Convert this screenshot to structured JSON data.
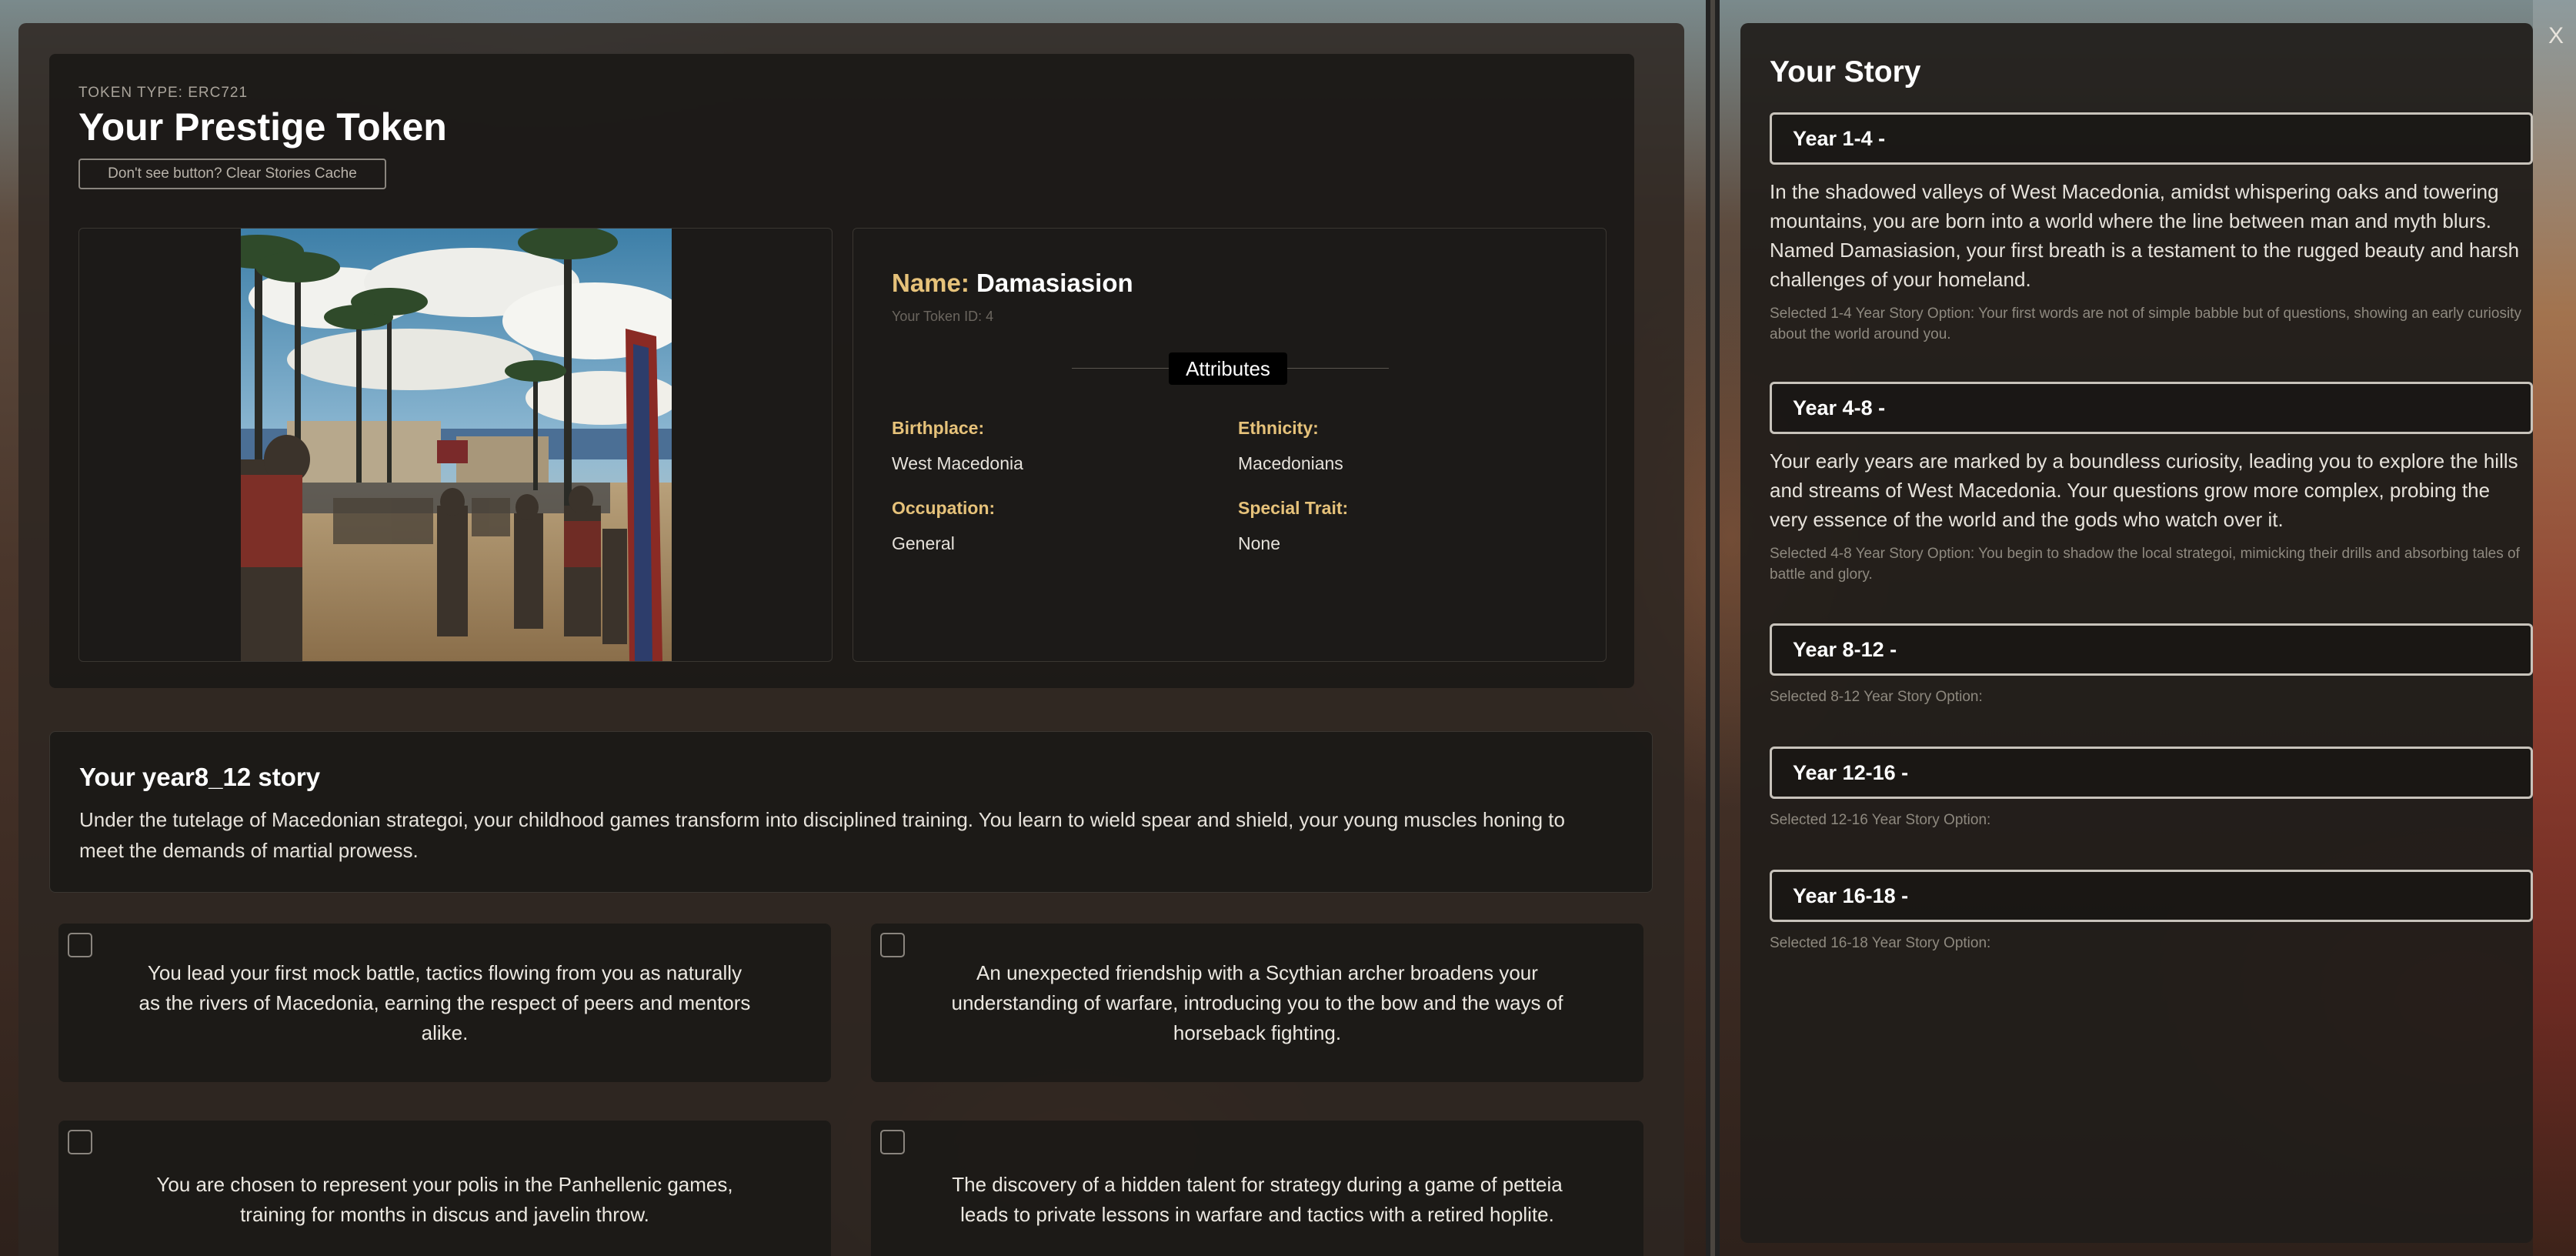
{
  "token": {
    "type_label": "TOKEN TYPE: ERC721",
    "title": "Your Prestige Token",
    "cache_button": "Don't see button? Clear Stories Cache",
    "name_label": "Name:",
    "name": "Damasiasion",
    "token_id": "Your Token ID: 4",
    "attributes_label": "Attributes",
    "attributes": [
      {
        "label": "Birthplace:",
        "value": "West Macedonia"
      },
      {
        "label": "Ethnicity:",
        "value": "Macedonians"
      },
      {
        "label": "Occupation:",
        "value": "General"
      },
      {
        "label": "Special Trait:",
        "value": "None"
      }
    ]
  },
  "current_story": {
    "title": "Your year8_12 story",
    "text": "Under the tutelage of Macedonian strategoi, your childhood games transform into disciplined training. You learn to wield spear and shield, your young muscles honing to meet the demands of martial prowess."
  },
  "options": [
    {
      "text": "You lead your first mock battle, tactics flowing from you as naturally as the rivers of Macedonia, earning the respect of peers and mentors alike.",
      "checked": false
    },
    {
      "text": "An unexpected friendship with a Scythian archer broadens your understanding of warfare, introducing you to the bow and the ways of horseback fighting.",
      "checked": false
    },
    {
      "text": "You are chosen to represent your polis in the Panhellenic games, training for months in discus and javelin throw.",
      "checked": false
    },
    {
      "text": "The discovery of a hidden talent for strategy during a game of petteia leads to private lessons in warfare and tactics with a retired hoplite.",
      "checked": false
    }
  ],
  "your_story": {
    "title": "Your Story",
    "close": "X",
    "years": [
      {
        "label": "Year 1-4 -",
        "story": "In the shadowed valleys of West Macedonia, amidst whispering oaks and towering mountains, you are born into a world where the line between man and myth blurs. Named Damasiasion, your first breath is a testament to the rugged beauty and harsh challenges of your homeland.",
        "selected": "Selected 1-4 Year Story Option: Your first words are not of simple babble but of questions, showing an early curiosity about the world around you."
      },
      {
        "label": "Year 4-8 -",
        "story": "Your early years are marked by a boundless curiosity, leading you to explore the hills and streams of West Macedonia. Your questions grow more complex, probing the very essence of the world and the gods who watch over it.",
        "selected": "Selected 4-8 Year Story Option: You begin to shadow the local strategoi, mimicking their drills and absorbing tales of battle and glory."
      },
      {
        "label": "Year 8-12 -",
        "story": "",
        "selected": "Selected 8-12 Year Story Option:"
      },
      {
        "label": "Year 12-16 -",
        "story": "",
        "selected": "Selected 12-16 Year Story Option:"
      },
      {
        "label": "Year 16-18 -",
        "story": "",
        "selected": "Selected 16-18 Year Story Option:"
      }
    ]
  },
  "colors": {
    "accent_gold": "#e6c27a",
    "panel_dark": "#1b1917"
  }
}
